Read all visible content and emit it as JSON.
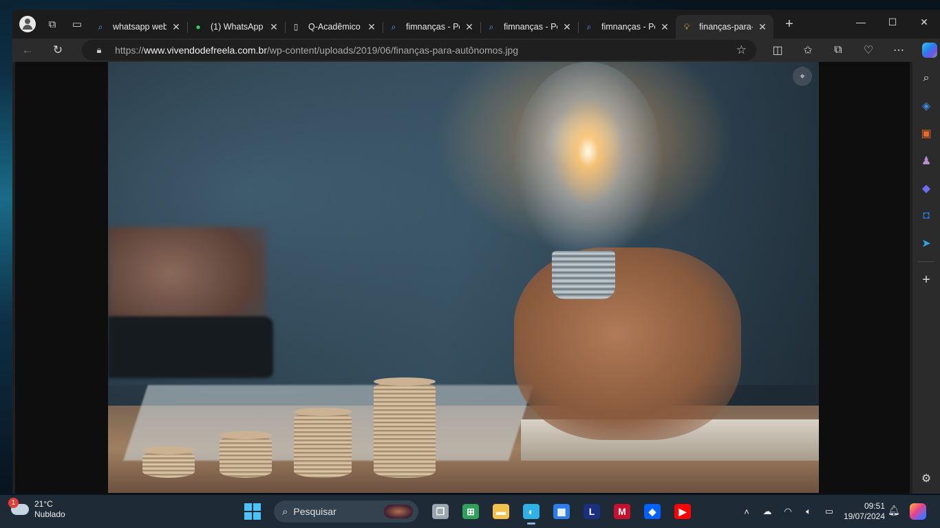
{
  "browser": {
    "tabs": [
      {
        "label": "whatsapp web",
        "icon": "search-icon",
        "active": false
      },
      {
        "label": "(1) WhatsApp",
        "icon": "whatsapp-icon",
        "active": false
      },
      {
        "label": "Q-Acadêmico V",
        "icon": "document-icon",
        "active": false
      },
      {
        "label": "fimnanças - Pe",
        "icon": "search-icon",
        "active": false
      },
      {
        "label": "fimnanças - Pe",
        "icon": "search-icon",
        "active": false
      },
      {
        "label": "fimnanças - Pe",
        "icon": "search-icon",
        "active": false
      },
      {
        "label": "finanças-para-",
        "icon": "lightbulb-icon",
        "active": true
      }
    ],
    "close_glyph": "✕",
    "new_tab_glyph": "+",
    "address": {
      "scheme": "https://",
      "domain": "www.vivendodefreela.com.br",
      "path": "/wp-content/uploads/2019/06/finanças-para-autônomos.jpg"
    }
  },
  "taskbar": {
    "weather": {
      "temp": "21°C",
      "condition": "Nublado",
      "badge": "1"
    },
    "search_placeholder": "Pesquisar",
    "apps": [
      {
        "name": "task-view-button",
        "glyph": "❐",
        "color": "#9aa5b0"
      },
      {
        "name": "spreadsheet-app-button",
        "glyph": "⊞",
        "color": "#2fa05a"
      },
      {
        "name": "file-explorer-button",
        "glyph": "▬",
        "color": "#f2c14e"
      },
      {
        "name": "edge-browser-button",
        "glyph": "◐",
        "color": "#2fb1e8"
      },
      {
        "name": "microsoft-store-button",
        "glyph": "▦",
        "color": "#2b7de9"
      },
      {
        "name": "l-app-button",
        "glyph": "L",
        "color": "#1b2f80"
      },
      {
        "name": "mcafee-button",
        "glyph": "M",
        "color": "#c8102e"
      },
      {
        "name": "dropbox-button",
        "glyph": "◆",
        "color": "#0061fe"
      },
      {
        "name": "youtube-button",
        "glyph": "▶",
        "color": "#ff0000"
      }
    ],
    "time": "09:51",
    "date": "19/07/2024"
  }
}
